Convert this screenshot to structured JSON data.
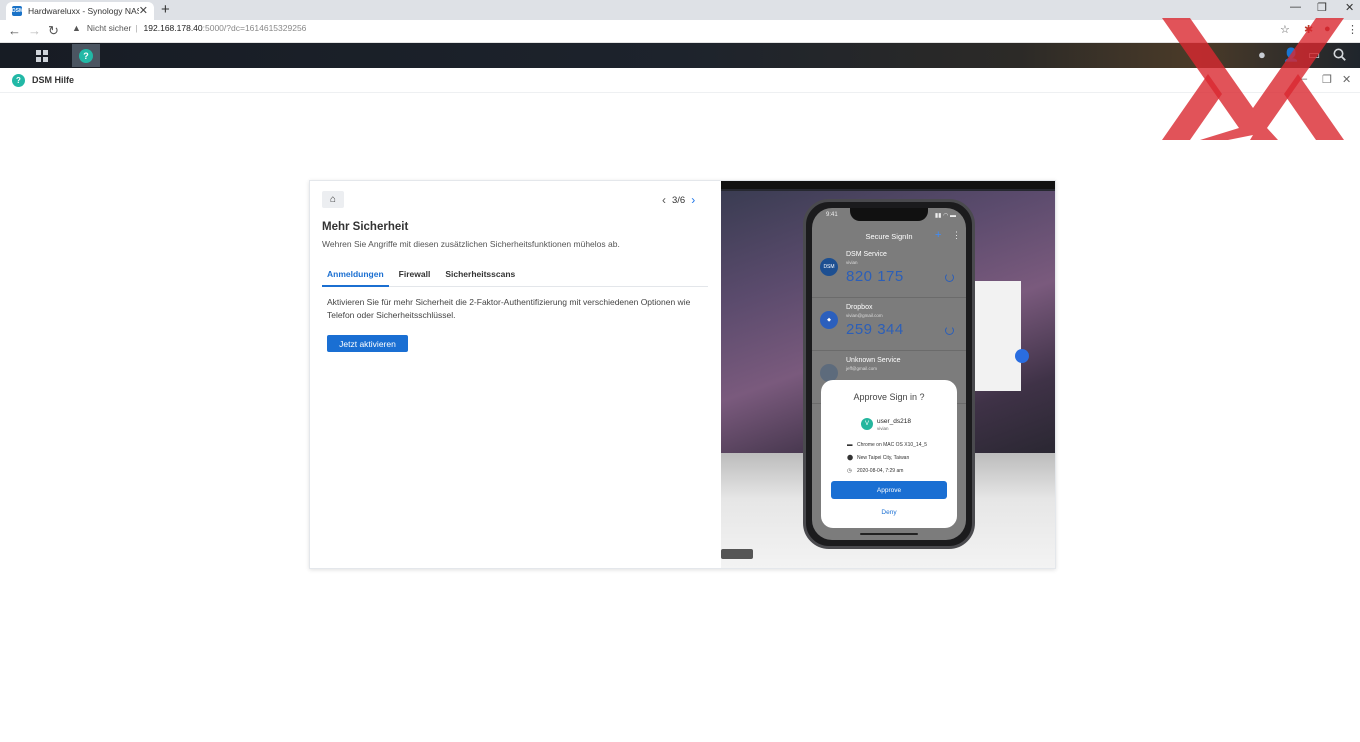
{
  "browser": {
    "tab_title": "Hardwareluxx - Synology NAS",
    "tab_favicon": "DSM",
    "security_label": "Nicht sicher",
    "url_host": "192.168.178.40",
    "url_rest": ":5000/?dc=1614615329256"
  },
  "help_window": {
    "title": "DSM Hilfe"
  },
  "card": {
    "pager": "3/6",
    "title": "Mehr Sicherheit",
    "subtitle": "Wehren Sie Angriffe mit diesen zusätzlichen Sicherheitsfunktionen mühelos ab.",
    "tabs": [
      {
        "label": "Anmeldungen",
        "active": true
      },
      {
        "label": "Firewall",
        "active": false
      },
      {
        "label": "Sicherheitsscans",
        "active": false
      }
    ],
    "description": "Aktivieren Sie für mehr Sicherheit die 2-Faktor-Authentifizierung mit verschiedenen Optionen wie Telefon oder Sicherheitsschlüssel.",
    "button_label": "Jetzt aktivieren"
  },
  "phone": {
    "time": "9:41",
    "app_title": "Secure SignIn",
    "items": [
      {
        "name": "DSM Service",
        "email": "vivian",
        "code": "820 175",
        "avatar": "DSM"
      },
      {
        "name": "Dropbox",
        "email": "vivian@gmail.com",
        "code": "259 344",
        "avatar": ""
      },
      {
        "name": "Unknown Service",
        "email": "jeff@gmail.com",
        "code": "",
        "avatar": ""
      }
    ],
    "approve": {
      "title": "Approve Sign in ?",
      "user_initial": "V",
      "user": "user_ds218",
      "user_sub": "vivian",
      "device": "Chrome on MAC OS X10_14_5",
      "location": "New Taipei City, Taiwan",
      "time": "2020-08-04, 7:29 am",
      "approve_label": "Approve",
      "deny_label": "Deny"
    }
  },
  "colors": {
    "accent": "#1a6fd3",
    "help_teal": "#22b8a6",
    "watermark_red": "#d9282f"
  }
}
